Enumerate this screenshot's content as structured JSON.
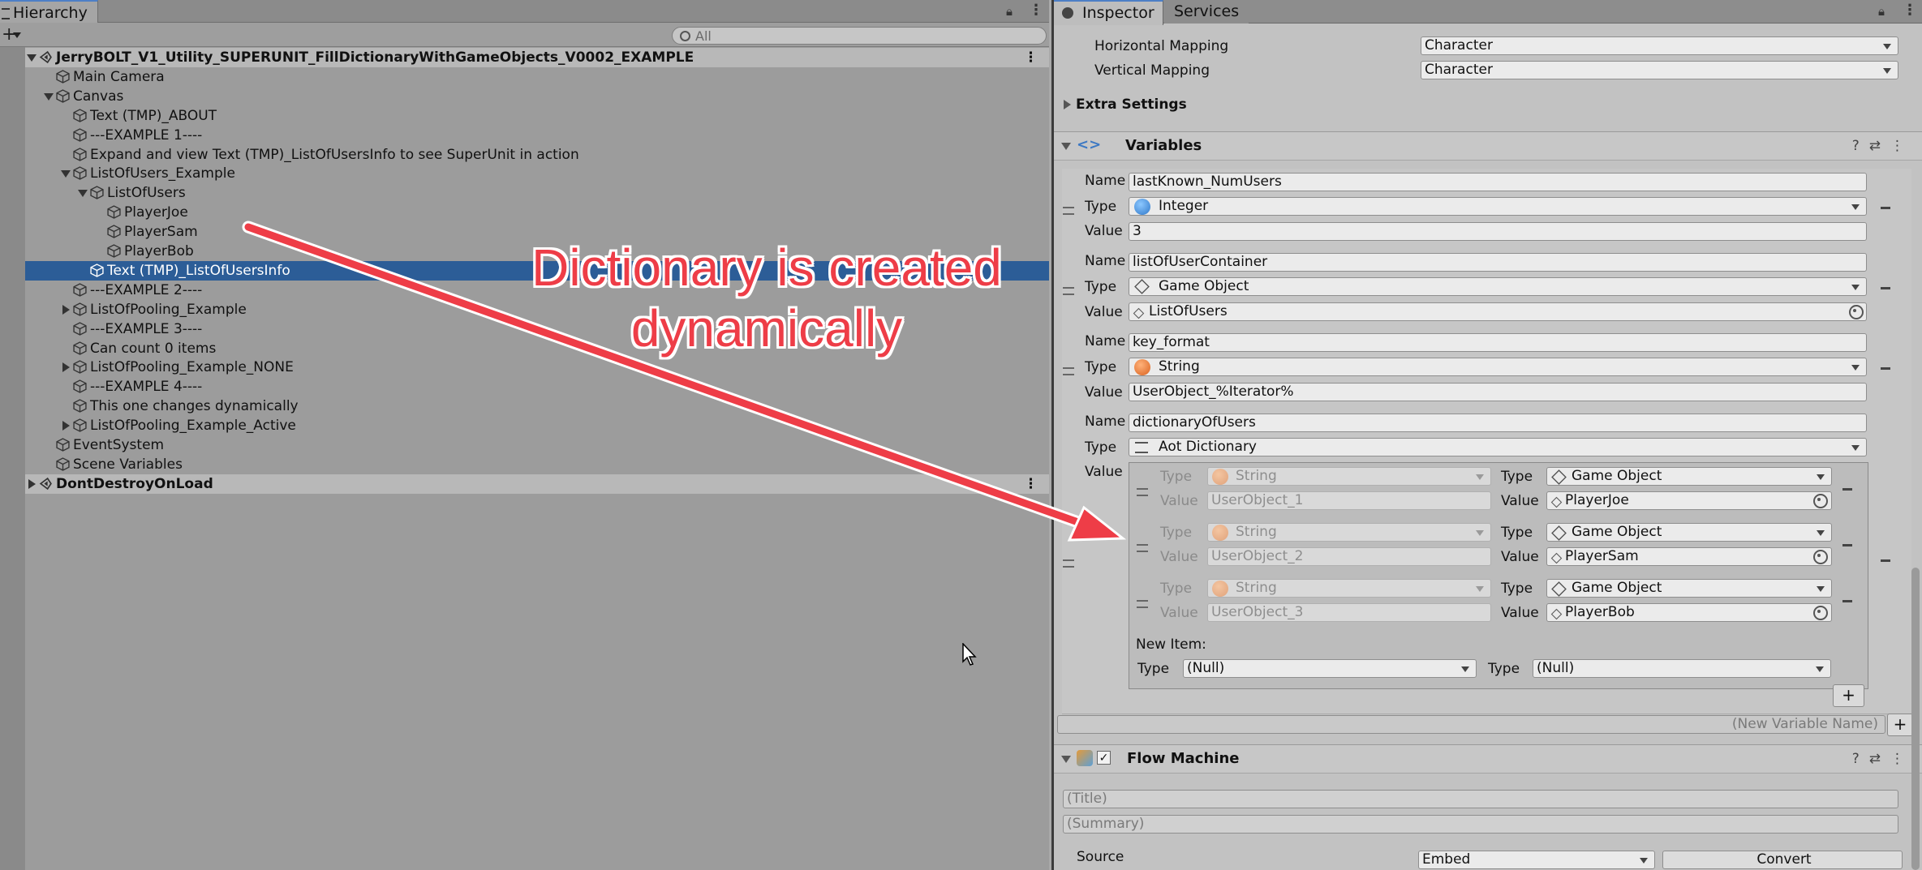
{
  "hierarchy": {
    "tab_label": "Hierarchy",
    "search_placeholder": "All",
    "rows": [
      {
        "label": "JerryBOLT_V1_Utility_SUPERUNIT_FillDictionaryWithGameObjects_V0002_EXAMPLE",
        "depth": 0,
        "expander": "down",
        "kind": "scene"
      },
      {
        "label": "Main Camera",
        "depth": 1,
        "expander": "none",
        "kind": "go"
      },
      {
        "label": "Canvas",
        "depth": 1,
        "expander": "down",
        "kind": "go"
      },
      {
        "label": "Text (TMP)_ABOUT",
        "depth": 2,
        "expander": "none",
        "kind": "go"
      },
      {
        "label": "---EXAMPLE 1----",
        "depth": 2,
        "expander": "none",
        "kind": "go"
      },
      {
        "label": "Expand and view Text (TMP)_ListOfUsersInfo to see SuperUnit in action",
        "depth": 2,
        "expander": "none",
        "kind": "go"
      },
      {
        "label": "ListOfUsers_Example",
        "depth": 2,
        "expander": "down",
        "kind": "go"
      },
      {
        "label": "ListOfUsers",
        "depth": 3,
        "expander": "down",
        "kind": "go"
      },
      {
        "label": "PlayerJoe",
        "depth": 4,
        "expander": "none",
        "kind": "go"
      },
      {
        "label": "PlayerSam",
        "depth": 4,
        "expander": "none",
        "kind": "go"
      },
      {
        "label": "PlayerBob",
        "depth": 4,
        "expander": "none",
        "kind": "go"
      },
      {
        "label": "Text (TMP)_ListOfUsersInfo",
        "depth": 3,
        "expander": "none",
        "kind": "selected"
      },
      {
        "label": "---EXAMPLE 2----",
        "depth": 2,
        "expander": "none",
        "kind": "go"
      },
      {
        "label": "ListOfPooling_Example",
        "depth": 2,
        "expander": "right",
        "kind": "go"
      },
      {
        "label": "---EXAMPLE 3----",
        "depth": 2,
        "expander": "none",
        "kind": "go"
      },
      {
        "label": "Can count 0 items",
        "depth": 2,
        "expander": "none",
        "kind": "go"
      },
      {
        "label": "ListOfPooling_Example_NONE",
        "depth": 2,
        "expander": "right",
        "kind": "go"
      },
      {
        "label": "---EXAMPLE 4----",
        "depth": 2,
        "expander": "none",
        "kind": "go"
      },
      {
        "label": "This one changes dynamically",
        "depth": 2,
        "expander": "none",
        "kind": "go"
      },
      {
        "label": "ListOfPooling_Example_Active",
        "depth": 2,
        "expander": "right",
        "kind": "go"
      },
      {
        "label": "EventSystem",
        "depth": 1,
        "expander": "none",
        "kind": "go"
      },
      {
        "label": "Scene Variables",
        "depth": 1,
        "expander": "none",
        "kind": "go"
      },
      {
        "label": "DontDestroyOnLoad",
        "depth": 0,
        "expander": "right",
        "kind": "scene"
      }
    ]
  },
  "inspector": {
    "tabs": [
      "Inspector",
      "Services"
    ],
    "horizontal_mapping": {
      "label": "Horizontal Mapping",
      "value": "Character"
    },
    "vertical_mapping": {
      "label": "Vertical Mapping",
      "value": "Character"
    },
    "extra_settings": "Extra Settings",
    "variables": {
      "title": "Variables",
      "labels": {
        "name": "Name",
        "type": "Type",
        "value": "Value"
      },
      "items": [
        {
          "name": "lastKnown_NumUsers",
          "type": "Integer",
          "value": "3"
        },
        {
          "name": "listOfUserContainer",
          "type": "Game Object",
          "value": "ListOfUsers"
        },
        {
          "name": "key_format",
          "type": "String",
          "value": "UserObject_%Iterator%"
        },
        {
          "name": "dictionaryOfUsers",
          "type": "Aot Dictionary",
          "value": ""
        }
      ],
      "dictionary": {
        "entries": [
          {
            "key_type": "String",
            "key_value": "UserObject_1",
            "value_type": "Game Object",
            "value": "PlayerJoe"
          },
          {
            "key_type": "String",
            "key_value": "UserObject_2",
            "value_type": "Game Object",
            "value": "PlayerSam"
          },
          {
            "key_type": "String",
            "key_value": "UserObject_3",
            "value_type": "Game Object",
            "value": "PlayerBob"
          }
        ],
        "new_item_label": "New Item:",
        "new_key_type": "(Null)",
        "new_value_type": "(Null)"
      },
      "new_variable_placeholder": "(New Variable Name)"
    },
    "flow_machine": {
      "title": "Flow Machine",
      "title_placeholder": "(Title)",
      "summary_placeholder": "(Summary)",
      "source_label": "Source",
      "source_value": "Embed",
      "convert_label": "Convert"
    }
  },
  "annotation": {
    "line1": "Dictionary is created",
    "line2": "dynamically",
    "color": "#ee3d47"
  },
  "colors": {
    "selection": "#2c5d97",
    "integer_icon": "#3f8fdc",
    "string_icon": "#e3823a"
  }
}
